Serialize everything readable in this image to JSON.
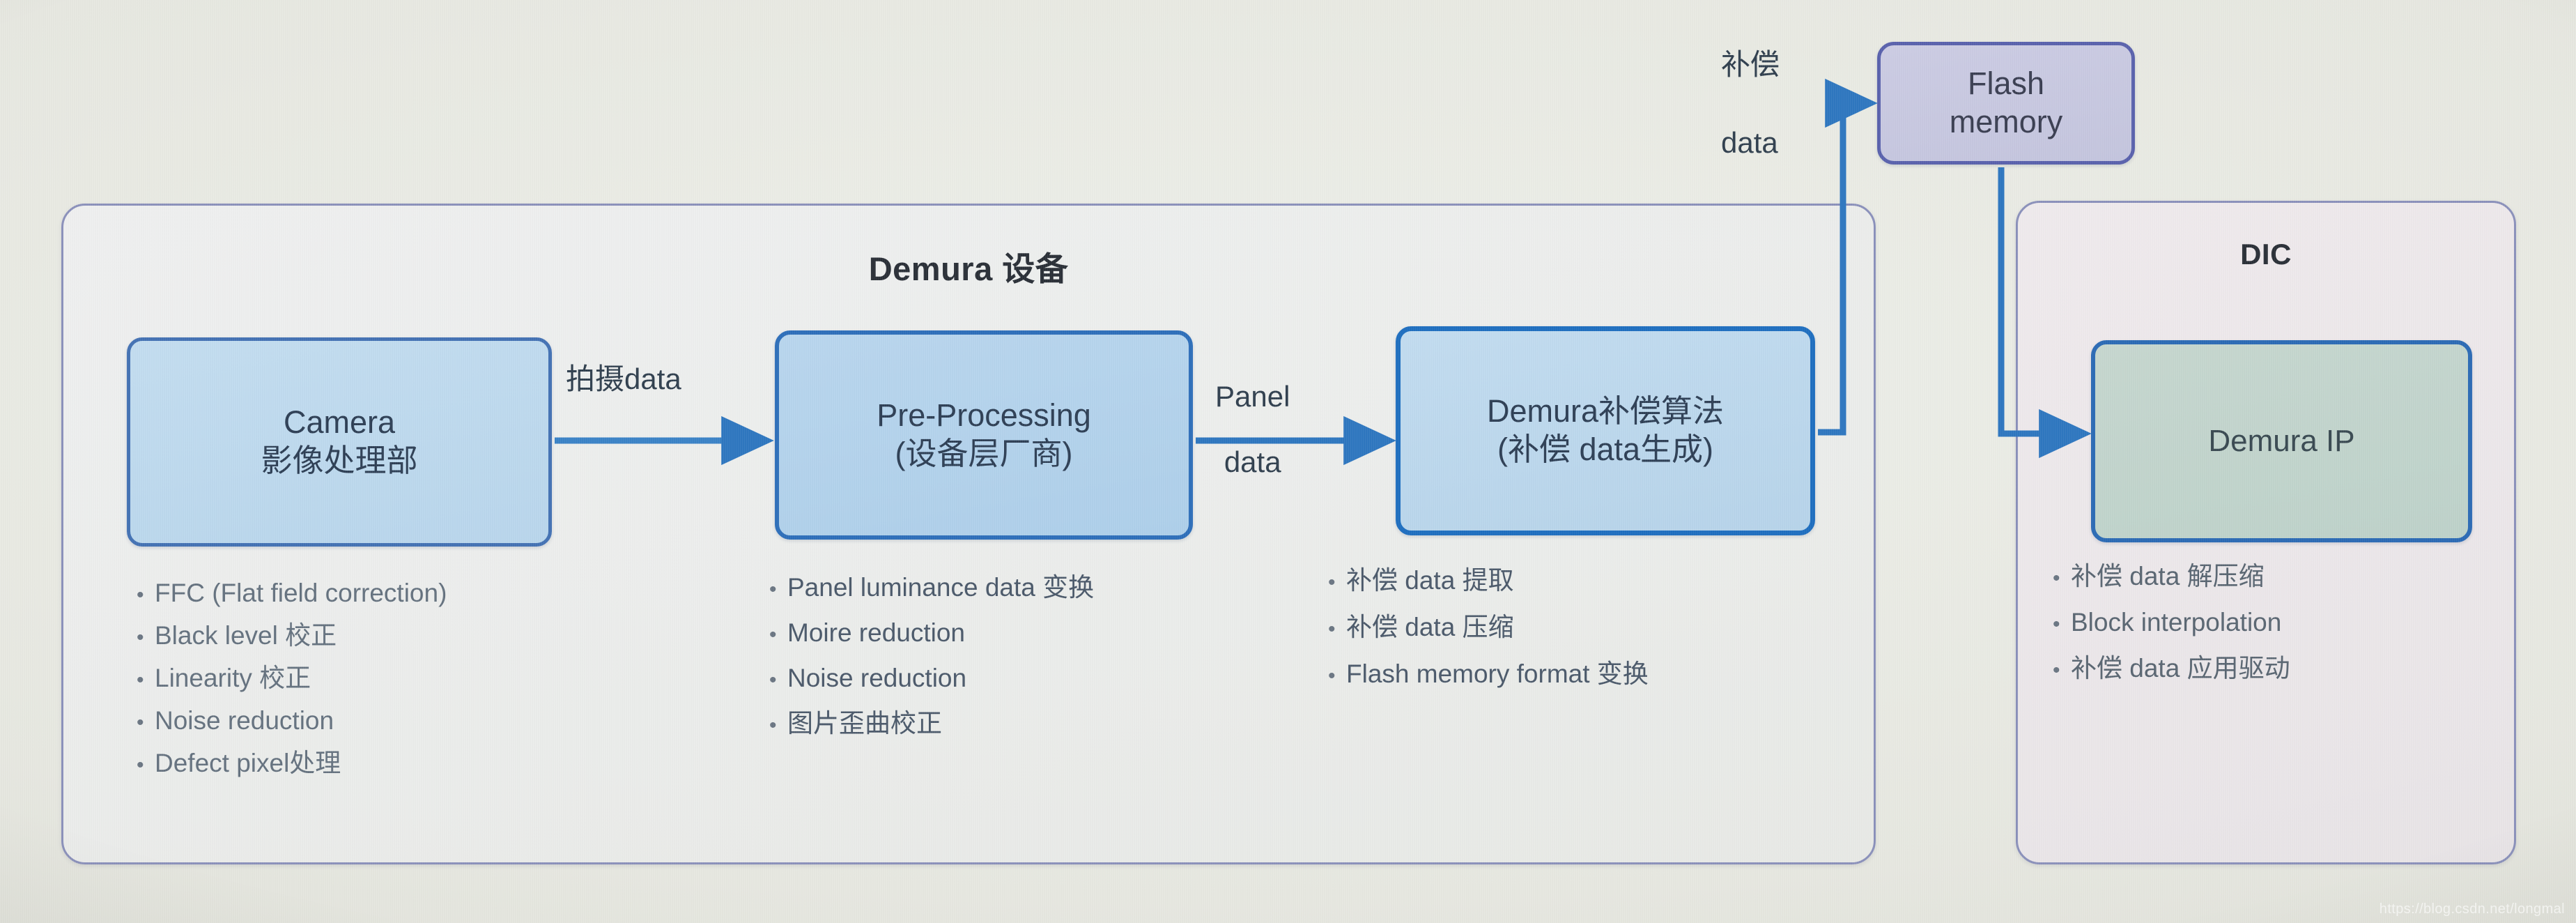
{
  "diagram": {
    "title_left": "Demura 设备",
    "title_right": "DIC"
  },
  "boxes": {
    "camera": {
      "line1": "Camera",
      "line2": "影像处理部"
    },
    "pre": {
      "line1": "Pre-Processing",
      "line2": "(设备层厂商)"
    },
    "algo": {
      "line1": "Demura补偿算法",
      "line2": "(补偿 data生成)"
    },
    "flash": {
      "line1": "Flash",
      "line2": "memory"
    },
    "demuraip": {
      "line1": "Demura IP",
      "line2": ""
    }
  },
  "connectors": {
    "camera_to_pre": "拍摄data",
    "pre_to_algo_l1": "Panel",
    "pre_to_algo_l2": "data",
    "algo_to_flash_l1": "补偿",
    "algo_to_flash_l2": "data"
  },
  "lists": {
    "camera": [
      "FFC (Flat field correction)",
      "Black level 校正",
      "Linearity 校正",
      "Noise reduction",
      "Defect pixel处理"
    ],
    "pre": [
      "Panel luminance data 变换",
      "Moire reduction",
      "Noise reduction",
      "图片歪曲校正"
    ],
    "algo": [
      "补偿 data 提取",
      "补偿 data 压缩",
      "Flash memory format 变换"
    ],
    "dic": [
      "补偿 data 解压缩",
      "Block interpolation",
      "补偿 data 应用驱动"
    ]
  },
  "bullet_glyph": "•",
  "watermark": "https://blog.csdn.net/longmal",
  "colors": {
    "arrow": "#2f77c0",
    "panel_border": "#8b91bb",
    "box_border_blue": "#2e6fba",
    "flash_fill": "#c8c9e2",
    "demuraip_fill": "#c2d5cc"
  }
}
